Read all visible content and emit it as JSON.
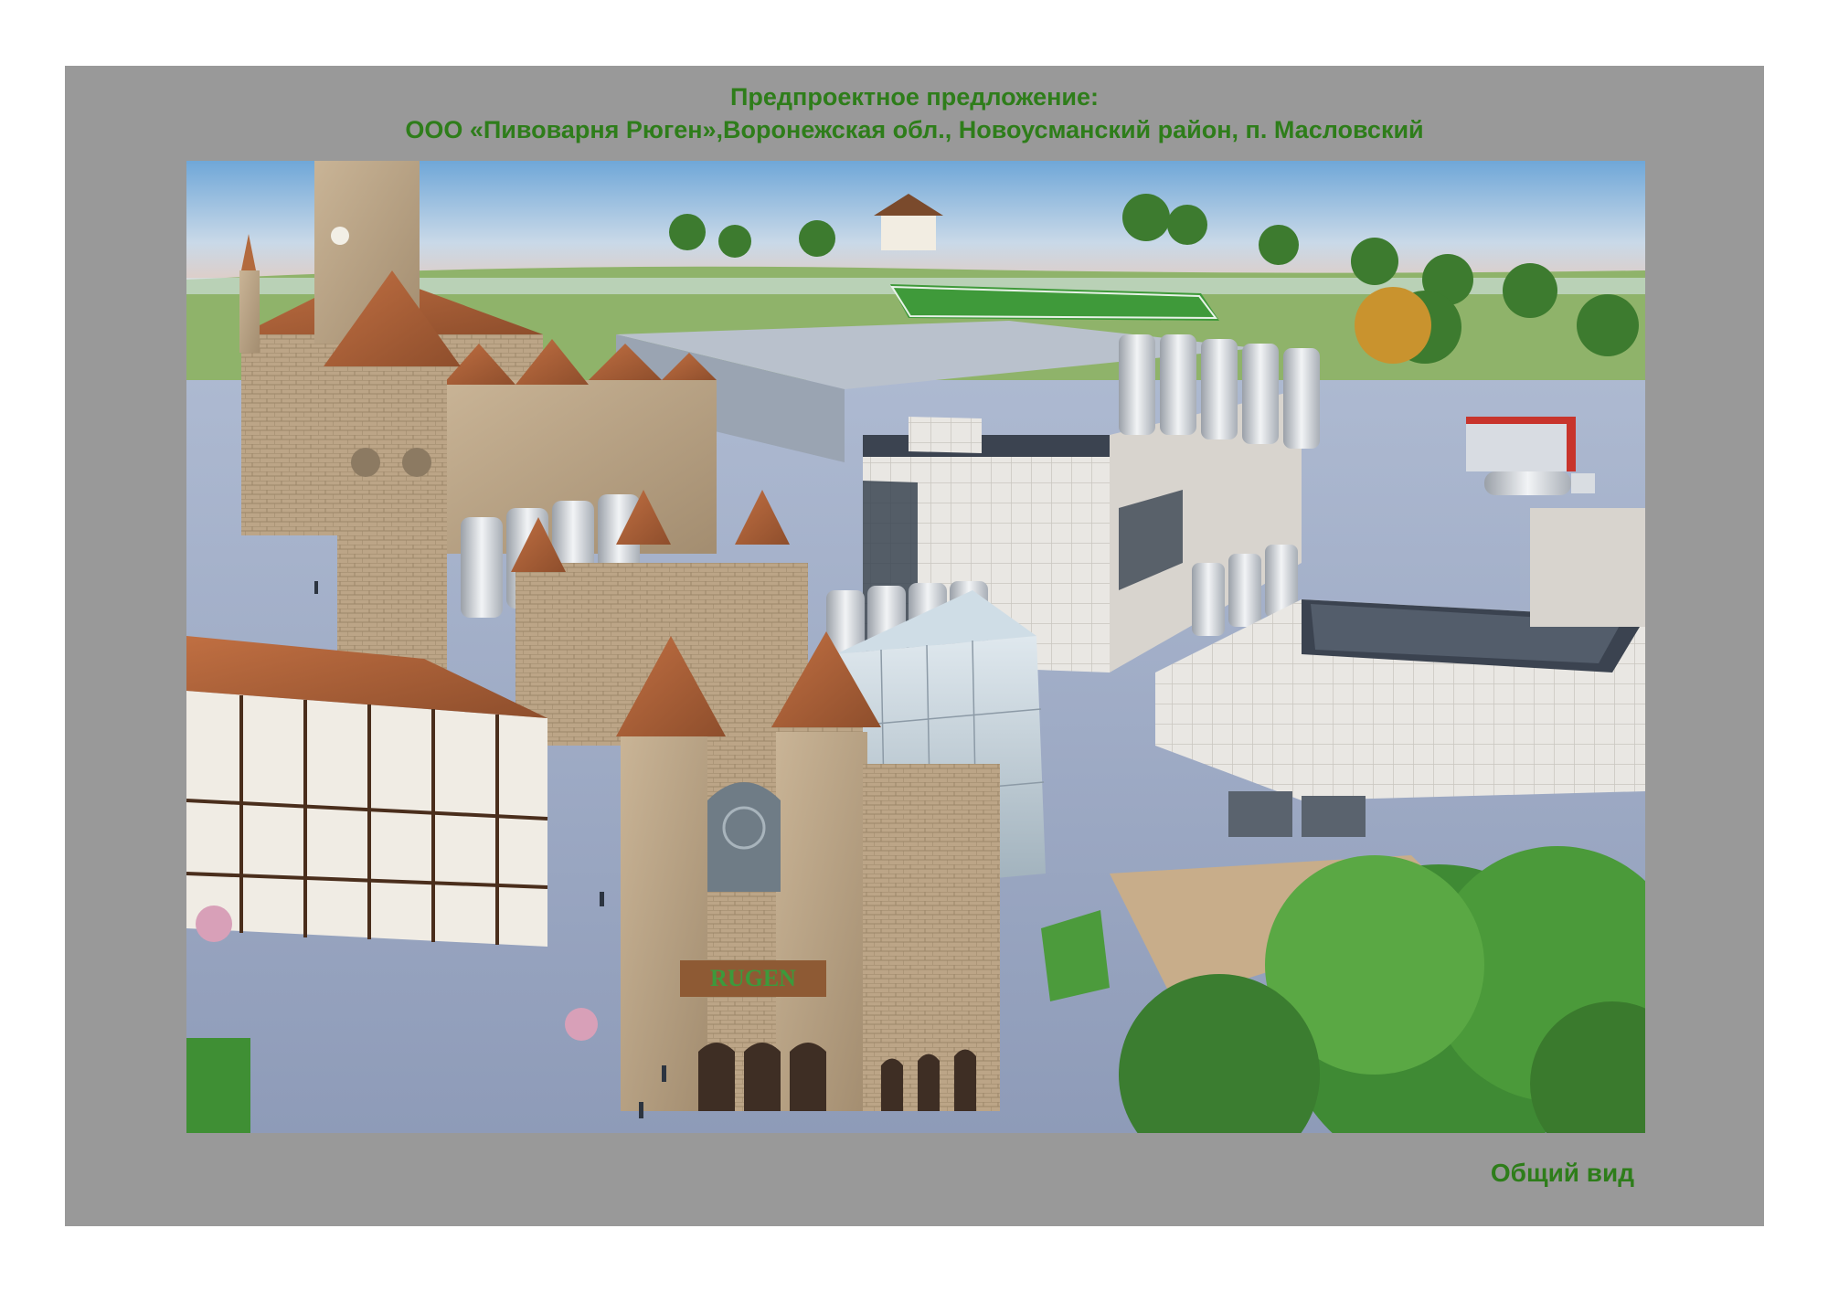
{
  "sheet": {
    "title_line1": "Предпроектное предложение:",
    "title_line2": "ООО «Пивоварня Рюген»,Воронежская обл., Новоусманский район, п. Масловский",
    "caption": "Общий вид"
  },
  "render": {
    "subject": "aerial-visualization-brewery-complex",
    "sign_text": "RUGEN"
  },
  "colors": {
    "sheet_bg": "#999999",
    "title_green": "#2e7d1a"
  }
}
